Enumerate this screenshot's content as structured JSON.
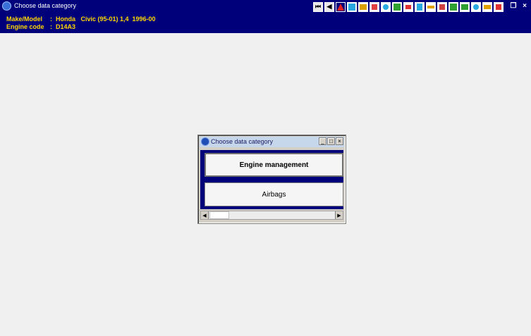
{
  "window": {
    "title": "Choose data category",
    "maximize_glyph": "❐",
    "close_glyph": "×"
  },
  "toolbar": {
    "nav_first": "⏮",
    "nav_prev": "◀",
    "icons": [
      {
        "name": "warning-icon",
        "color": "#e02020"
      },
      {
        "name": "document-icon",
        "color": "#2aa9e0"
      },
      {
        "name": "engine-icon",
        "color": "#d9a000"
      },
      {
        "name": "wrench-icon",
        "color": "#e04040"
      },
      {
        "name": "filter-icon",
        "color": "#2aa9e0"
      },
      {
        "name": "diagram-icon",
        "color": "#30a030"
      },
      {
        "name": "bulb-icon",
        "color": "#e03030"
      },
      {
        "name": "chart-icon",
        "color": "#2aa9e0"
      },
      {
        "name": "list-icon",
        "color": "#e0a000"
      },
      {
        "name": "gauge-icon",
        "color": "#d04040"
      },
      {
        "name": "map-icon",
        "color": "#30a030"
      },
      {
        "name": "monitor-icon",
        "color": "#30a030"
      },
      {
        "name": "settings-icon",
        "color": "#2aa9e0"
      },
      {
        "name": "tools-icon",
        "color": "#e0a000"
      },
      {
        "name": "exit-icon",
        "color": "#e03030"
      }
    ]
  },
  "vehicle": {
    "make_label": "Make/Model",
    "make_value": "Honda   Civic (95-01) 1,4  1996-00",
    "engine_label": "Engine code",
    "engine_value": "D14A3",
    "separator": ":"
  },
  "dialog": {
    "title": "Choose data category",
    "minimize_glyph": "_",
    "maximize_glyph": "□",
    "close_glyph": "×",
    "categories": [
      {
        "label": "Engine management"
      },
      {
        "label": "Airbags"
      }
    ],
    "scroll_left_glyph": "◀",
    "scroll_right_glyph": "▶"
  }
}
